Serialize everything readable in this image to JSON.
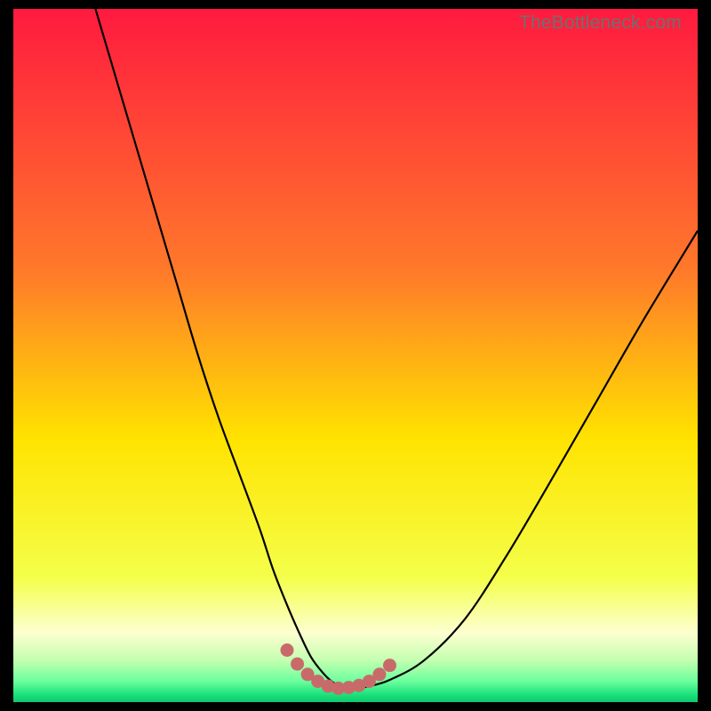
{
  "watermark": "TheBottleneck.com",
  "colors": {
    "black": "#000000",
    "gradient_top": "#ff1a3f",
    "gradient_mid_upper": "#ff7a2a",
    "gradient_mid": "#ffe300",
    "gradient_lower": "#f4ff4a",
    "gradient_pale": "#fdffd0",
    "gradient_green": "#18e07a",
    "curve": "#000000",
    "dots": "#c96a6a"
  },
  "chart_data": {
    "type": "line",
    "title": "",
    "xlabel": "",
    "ylabel": "",
    "xlim": [
      0,
      100
    ],
    "ylim": [
      0,
      100
    ],
    "series": [
      {
        "name": "bottleneck-curve",
        "x": [
          12,
          15,
          18,
          21,
          24,
          27,
          30,
          33,
          36,
          38,
          40,
          42,
          43.5,
          45,
          46.5,
          48,
          50,
          52,
          55,
          60,
          66,
          72,
          78,
          85,
          92,
          100
        ],
        "y": [
          100,
          90,
          80,
          70,
          60,
          50,
          41,
          33,
          25,
          19,
          14,
          9.5,
          6.5,
          4.5,
          3,
          2.2,
          2,
          2.3,
          3.2,
          6,
          12,
          21,
          31,
          43,
          55,
          68
        ]
      }
    ],
    "dots": {
      "name": "optimal-range-dots",
      "x": [
        40,
        41.5,
        43,
        44.5,
        46,
        47.5,
        49,
        50.5,
        52,
        53.5,
        55
      ],
      "y": [
        7.5,
        5.5,
        4,
        3,
        2.3,
        2,
        2.1,
        2.4,
        3,
        4,
        5.3
      ]
    },
    "gradient_stops_pct": [
      0,
      38,
      62,
      82,
      90,
      94,
      97,
      99,
      100
    ],
    "gradient_colors": [
      "#ff1a3f",
      "#ff7a2a",
      "#ffe300",
      "#f4ff4a",
      "#fdffd0",
      "#c3ffb0",
      "#6bff9d",
      "#18e07a",
      "#10c86c"
    ]
  }
}
